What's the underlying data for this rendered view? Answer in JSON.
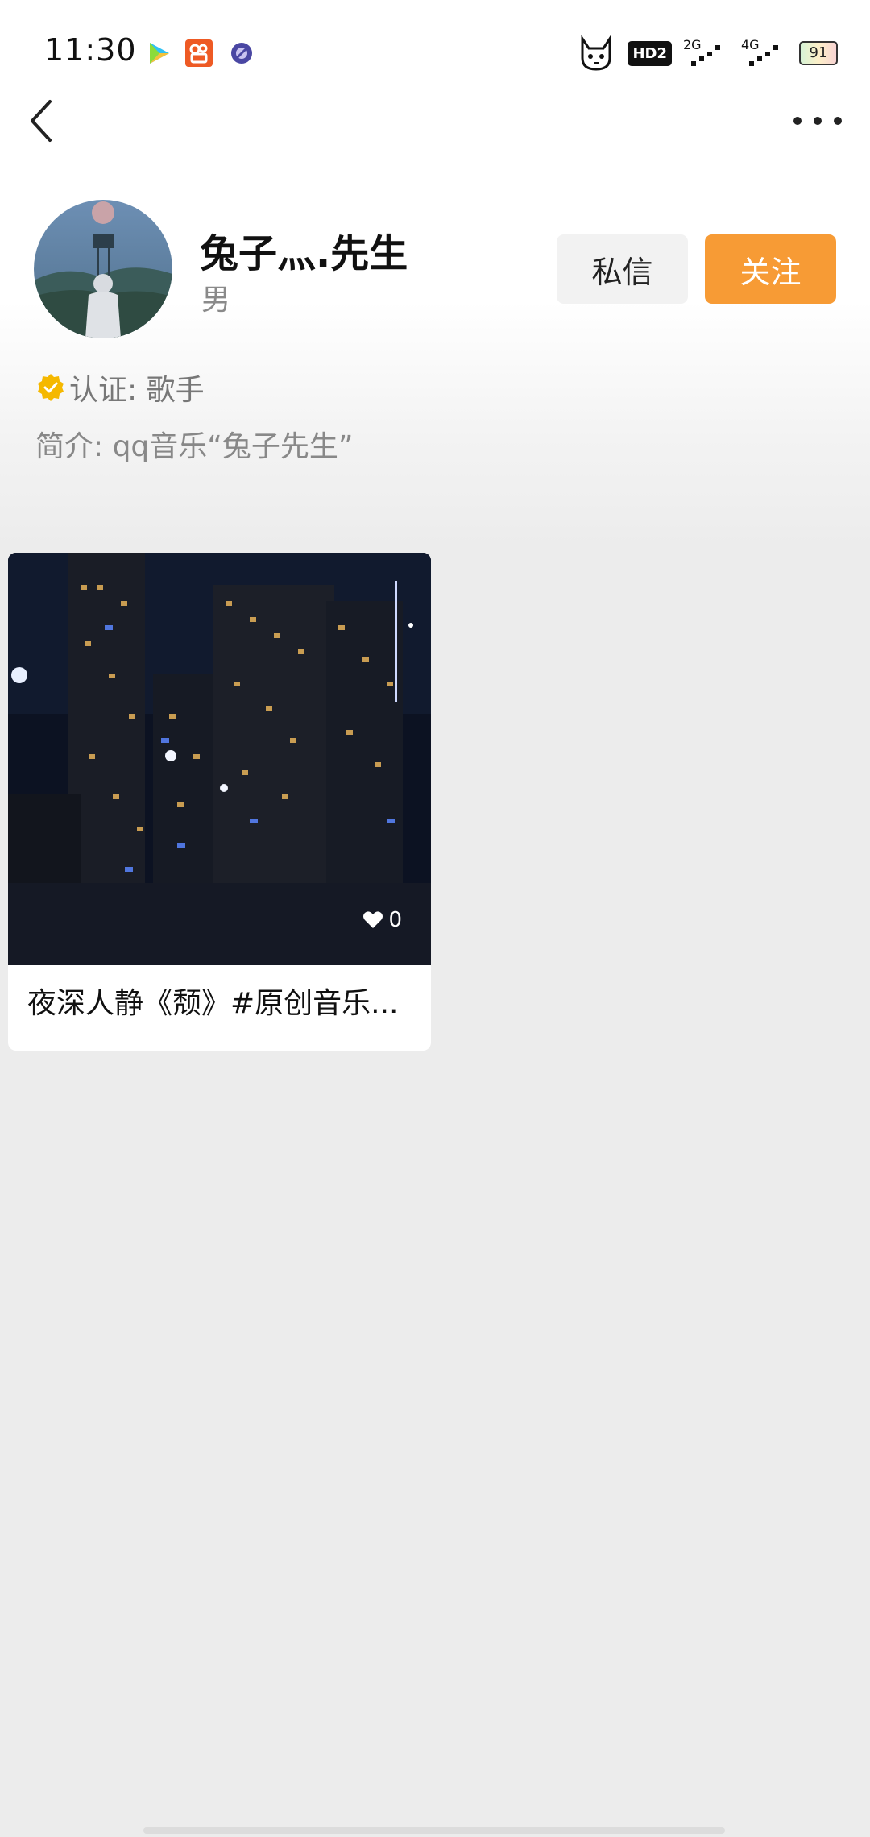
{
  "status_bar": {
    "time": "11:30",
    "hd_label": "HD2",
    "network_1": "2G",
    "network_2": "4G",
    "battery": "91",
    "icons": [
      "video-app-icon",
      "kuaishou-app-icon",
      "browser-app-icon",
      "cat-icon"
    ]
  },
  "nav": {
    "back_icon": "chevron-left-icon",
    "more_icon": "more-horizontal-icon"
  },
  "profile": {
    "name": "兔子灬.先生",
    "gender": "男",
    "message_button": "私信",
    "follow_button": "关注",
    "certification": "认证: 歌手",
    "bio": "简介: qq音乐“兔子先生”"
  },
  "posts": [
    {
      "title": "夜深人静《颓》#原创音乐...",
      "likes": "0"
    }
  ],
  "colors": {
    "accent": "#f79b35",
    "background": "#ececec",
    "verified_badge": "#f5b800"
  }
}
